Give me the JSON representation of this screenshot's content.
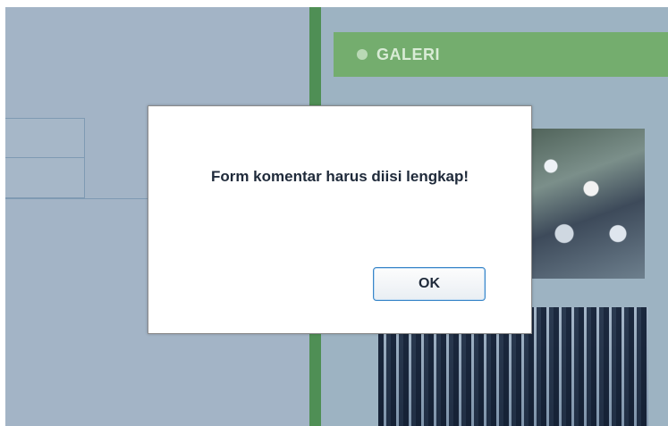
{
  "galeri": {
    "title": "GALERI"
  },
  "dialog": {
    "message": "Form komentar harus diisi lengkap!",
    "ok_label": "OK"
  },
  "colors": {
    "accent_green": "#4f8f55",
    "header_green": "#74ad6e",
    "button_border": "#3a86c8"
  }
}
